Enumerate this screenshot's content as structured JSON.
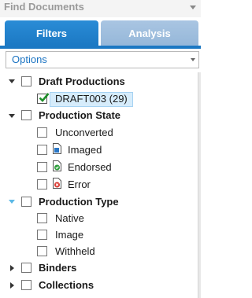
{
  "header": {
    "title": "Find Documents"
  },
  "tabs": [
    {
      "label": "Filters",
      "active": true
    },
    {
      "label": "Analysis",
      "active": false
    }
  ],
  "options": {
    "label": "Options"
  },
  "tree": {
    "draft_productions": {
      "label": "Draft Productions",
      "items": [
        {
          "label": "DRAFT003 (29)",
          "checked": true
        }
      ]
    },
    "production_state": {
      "label": "Production State",
      "items": [
        {
          "label": "Unconverted",
          "icon": "none"
        },
        {
          "label": "Imaged",
          "icon": "imaged-doc-icon"
        },
        {
          "label": "Endorsed",
          "icon": "endorsed-doc-icon"
        },
        {
          "label": "Error",
          "icon": "error-doc-icon"
        }
      ]
    },
    "production_type": {
      "label": "Production Type",
      "items": [
        {
          "label": "Native"
        },
        {
          "label": "Image"
        },
        {
          "label": "Withheld"
        }
      ]
    },
    "binders": {
      "label": "Binders"
    },
    "collections": {
      "label": "Collections"
    }
  },
  "colors": {
    "tab_active": "#1b78c3",
    "tab_inactive": "#a9c5e2",
    "options_text": "#1a73c2",
    "selection": "#d6ecfb"
  }
}
